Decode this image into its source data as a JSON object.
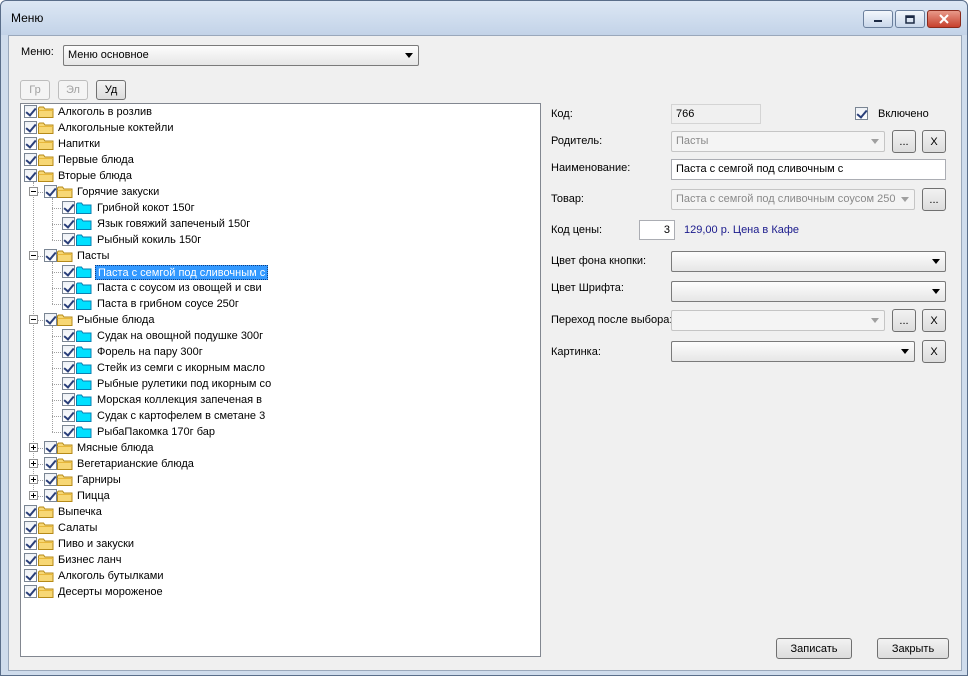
{
  "window": {
    "title": "Меню"
  },
  "menu_select": {
    "label": "Меню:",
    "value": "Меню основное"
  },
  "toolbar": {
    "group_label": "Гр",
    "element_label": "Эл",
    "delete_label": "Уд"
  },
  "tree": {
    "items": [
      {
        "label": "Алкоголь в розлив",
        "type": "folder",
        "level": 0
      },
      {
        "label": "Алкогольные коктейли",
        "type": "folder",
        "level": 0
      },
      {
        "label": "Напитки",
        "type": "folder",
        "level": 0
      },
      {
        "label": "Первые блюда",
        "type": "folder",
        "level": 0
      },
      {
        "label": "Вторые блюда",
        "type": "folder",
        "level": 0
      },
      {
        "label": "Горячие закуски",
        "type": "folder",
        "level": 1,
        "expander": "minus"
      },
      {
        "label": "Грибной кокот 150г",
        "type": "item",
        "level": 2
      },
      {
        "label": "Язык говяжий запеченый 150г",
        "type": "item",
        "level": 2
      },
      {
        "label": "Рыбный кокиль 150г",
        "type": "item",
        "level": 2
      },
      {
        "label": "Пасты",
        "type": "folder",
        "level": 1,
        "expander": "minus"
      },
      {
        "label": "Паста с семгой под сливочным с",
        "type": "item",
        "level": 2,
        "selected": true
      },
      {
        "label": "Паста с соусом из овощей и сви",
        "type": "item",
        "level": 2
      },
      {
        "label": "Паста в грибном соусе 250г",
        "type": "item",
        "level": 2
      },
      {
        "label": "Рыбные блюда",
        "type": "folder",
        "level": 1,
        "expander": "minus"
      },
      {
        "label": "Судак на овощной подушке 300г",
        "type": "item",
        "level": 2
      },
      {
        "label": "Форель на пару 300г",
        "type": "item",
        "level": 2
      },
      {
        "label": "Стейк из семги с икорным масло",
        "type": "item",
        "level": 2
      },
      {
        "label": "Рыбные рулетики под икорным со",
        "type": "item",
        "level": 2
      },
      {
        "label": "Морская коллекция запеченая в",
        "type": "item",
        "level": 2
      },
      {
        "label": "Судак с картофелем в сметане 3",
        "type": "item",
        "level": 2
      },
      {
        "label": "РыбаПакомка 170г бар",
        "type": "item",
        "level": 2
      },
      {
        "label": "Мясные блюда",
        "type": "folder",
        "level": 1,
        "expander": "plus"
      },
      {
        "label": "Вегетарианские блюда",
        "type": "folder",
        "level": 1,
        "expander": "plus"
      },
      {
        "label": "Гарниры",
        "type": "folder",
        "level": 1,
        "expander": "plus"
      },
      {
        "label": "Пицца",
        "type": "folder",
        "level": 1,
        "expander": "plus"
      },
      {
        "label": "Выпечка",
        "type": "folder",
        "level": 0
      },
      {
        "label": "Салаты",
        "type": "folder",
        "level": 0
      },
      {
        "label": "Пиво и закуски",
        "type": "folder",
        "level": 0
      },
      {
        "label": "Бизнес ланч",
        "type": "folder",
        "level": 0
      },
      {
        "label": "Алкоголь бутылками",
        "type": "folder",
        "level": 0
      },
      {
        "label": "Десерты  мороженое",
        "type": "folder",
        "level": 0
      }
    ]
  },
  "form": {
    "code_label": "Код:",
    "code_value": "766",
    "enabled_label": "Включено",
    "parent_label": "Родитель:",
    "parent_value": "Пасты",
    "name_label": "Наименование:",
    "name_value": "Паста с семгой под сливочным с",
    "product_label": "Товар:",
    "product_value": "Паста с семгой под сливочным соусом 250",
    "price_code_label": "Код цены:",
    "price_code_value": "3",
    "price_info": "129,00 р. Цена в Кафе",
    "button_color_label": "Цвет фона кнопки:",
    "button_color_value": "",
    "font_color_label": "Цвет Шрифта:",
    "font_color_value": "",
    "after_select_label": "Переход после выбора:",
    "after_select_value": "",
    "picture_label": "Картинка:",
    "picture_value": "",
    "ellipsis": "...",
    "clear": "X"
  },
  "footer": {
    "save_label": "Записать",
    "close_label": "Закрыть"
  },
  "colors": {
    "selection": "#3399ff",
    "price_info": "#1a1a8c",
    "title_bar": "#c3d3e8"
  }
}
